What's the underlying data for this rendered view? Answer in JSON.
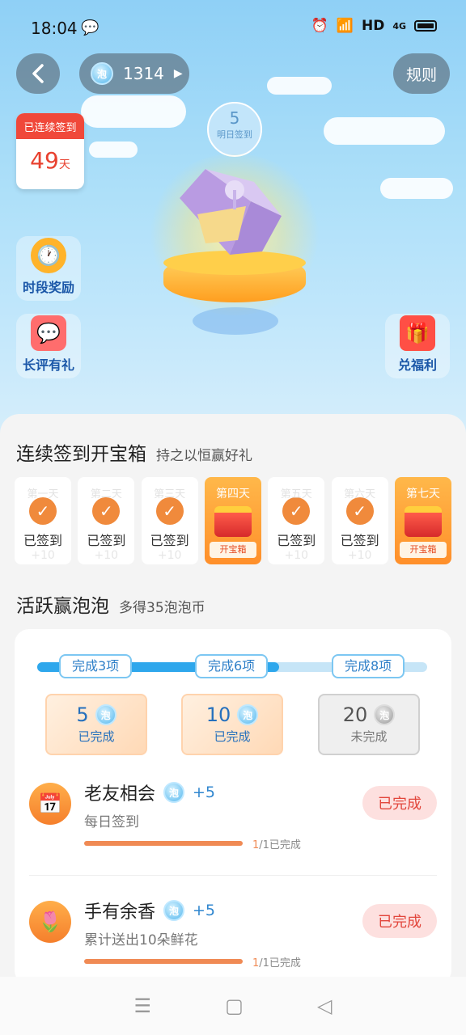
{
  "status_bar": {
    "time": "18:04",
    "network": "HD",
    "signal_label": "4G"
  },
  "header": {
    "coin_balance": "1314",
    "rule_label": "规则",
    "coin_glyph": "泡"
  },
  "streak": {
    "label": "已连续签到",
    "days": "49",
    "unit": "天"
  },
  "tomorrow": {
    "days": "5",
    "label": "明日签到"
  },
  "side_buttons": {
    "timed_reward": "时段奖励",
    "review_gift": "长评有礼",
    "redeem": "兑福利"
  },
  "checkin": {
    "title": "连续签到开宝箱",
    "subtitle": "持之以恒赢好礼",
    "days": [
      {
        "label": "第一天",
        "state": "已签到",
        "points": "+10",
        "type": "signed"
      },
      {
        "label": "第二天",
        "state": "已签到",
        "points": "+10",
        "type": "signed"
      },
      {
        "label": "第三天",
        "state": "已签到",
        "points": "+10",
        "type": "signed"
      },
      {
        "label": "第四天",
        "state": "开宝箱",
        "type": "box"
      },
      {
        "label": "第五天",
        "state": "已签到",
        "points": "+10",
        "type": "signed"
      },
      {
        "label": "第六天",
        "state": "已签到",
        "points": "+10",
        "type": "signed"
      },
      {
        "label": "第七天",
        "state": "开宝箱",
        "type": "box"
      }
    ]
  },
  "activity": {
    "title": "活跃赢泡泡",
    "subtitle": "多得35泡泡币",
    "progress_fraction": 0.62,
    "milestones": [
      "完成3项",
      "完成6项",
      "完成8项"
    ],
    "rewards": [
      {
        "amount": "5",
        "status": "已完成",
        "done": true
      },
      {
        "amount": "10",
        "status": "已完成",
        "done": true
      },
      {
        "amount": "20",
        "status": "未完成",
        "done": false
      }
    ]
  },
  "tasks": [
    {
      "name": "老友相会",
      "bonus": "+5",
      "desc": "每日签到",
      "progress_done": "1",
      "progress_rest": "/1已完成",
      "button": "已完成",
      "progress": 1.0
    },
    {
      "name": "手有余香",
      "bonus": "+5",
      "desc": "累计送出10朵鲜花",
      "progress_done": "1",
      "progress_rest": "/1已完成",
      "button": "已完成",
      "progress": 1.0
    }
  ],
  "colors": {
    "accent_orange": "#f08a3c",
    "coin_blue": "#56b8ee",
    "done_red": "#e2463c"
  }
}
